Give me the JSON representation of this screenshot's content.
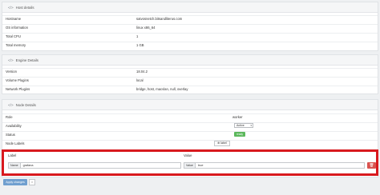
{
  "host_details": {
    "title": "Host details",
    "rows": [
      {
        "key": "Hostname",
        "value": "satvosnetch.bitsandliterus.com"
      },
      {
        "key": "OS information",
        "value": "linux x86_64"
      },
      {
        "key": "Total CPU",
        "value": "1"
      },
      {
        "key": "Total memory",
        "value": "1 GB"
      }
    ]
  },
  "engine_details": {
    "title": "Engine Details",
    "rows": [
      {
        "key": "Version",
        "value": "18.04.2"
      },
      {
        "key": "Volume Plugins",
        "value": "local"
      },
      {
        "key": "Network Plugins",
        "value": "bridge, host, macvlan, null, overlay"
      }
    ]
  },
  "node_details": {
    "title": "Node Details",
    "rows": {
      "role": {
        "key": "Role",
        "value": "worker"
      },
      "availability": {
        "key": "Availability",
        "value": "Active"
      },
      "status": {
        "key": "Status",
        "value": "ready"
      },
      "node_labels": {
        "key": "Node Labels",
        "button": "label"
      }
    }
  },
  "labels_editor": {
    "label_header": "Label",
    "value_header": "Value",
    "name_addon": "Name",
    "name_value": "grafana",
    "value_addon": "Value",
    "value_value": "true",
    "delete_icon": "trash-icon"
  },
  "actions": {
    "apply": "Apply changes",
    "extra": "×"
  },
  "colors": {
    "highlight_border": "#d8191e",
    "status_ready": "#5cb85c",
    "delete_button": "#d9534f",
    "apply_button": "#6f9fcf"
  }
}
